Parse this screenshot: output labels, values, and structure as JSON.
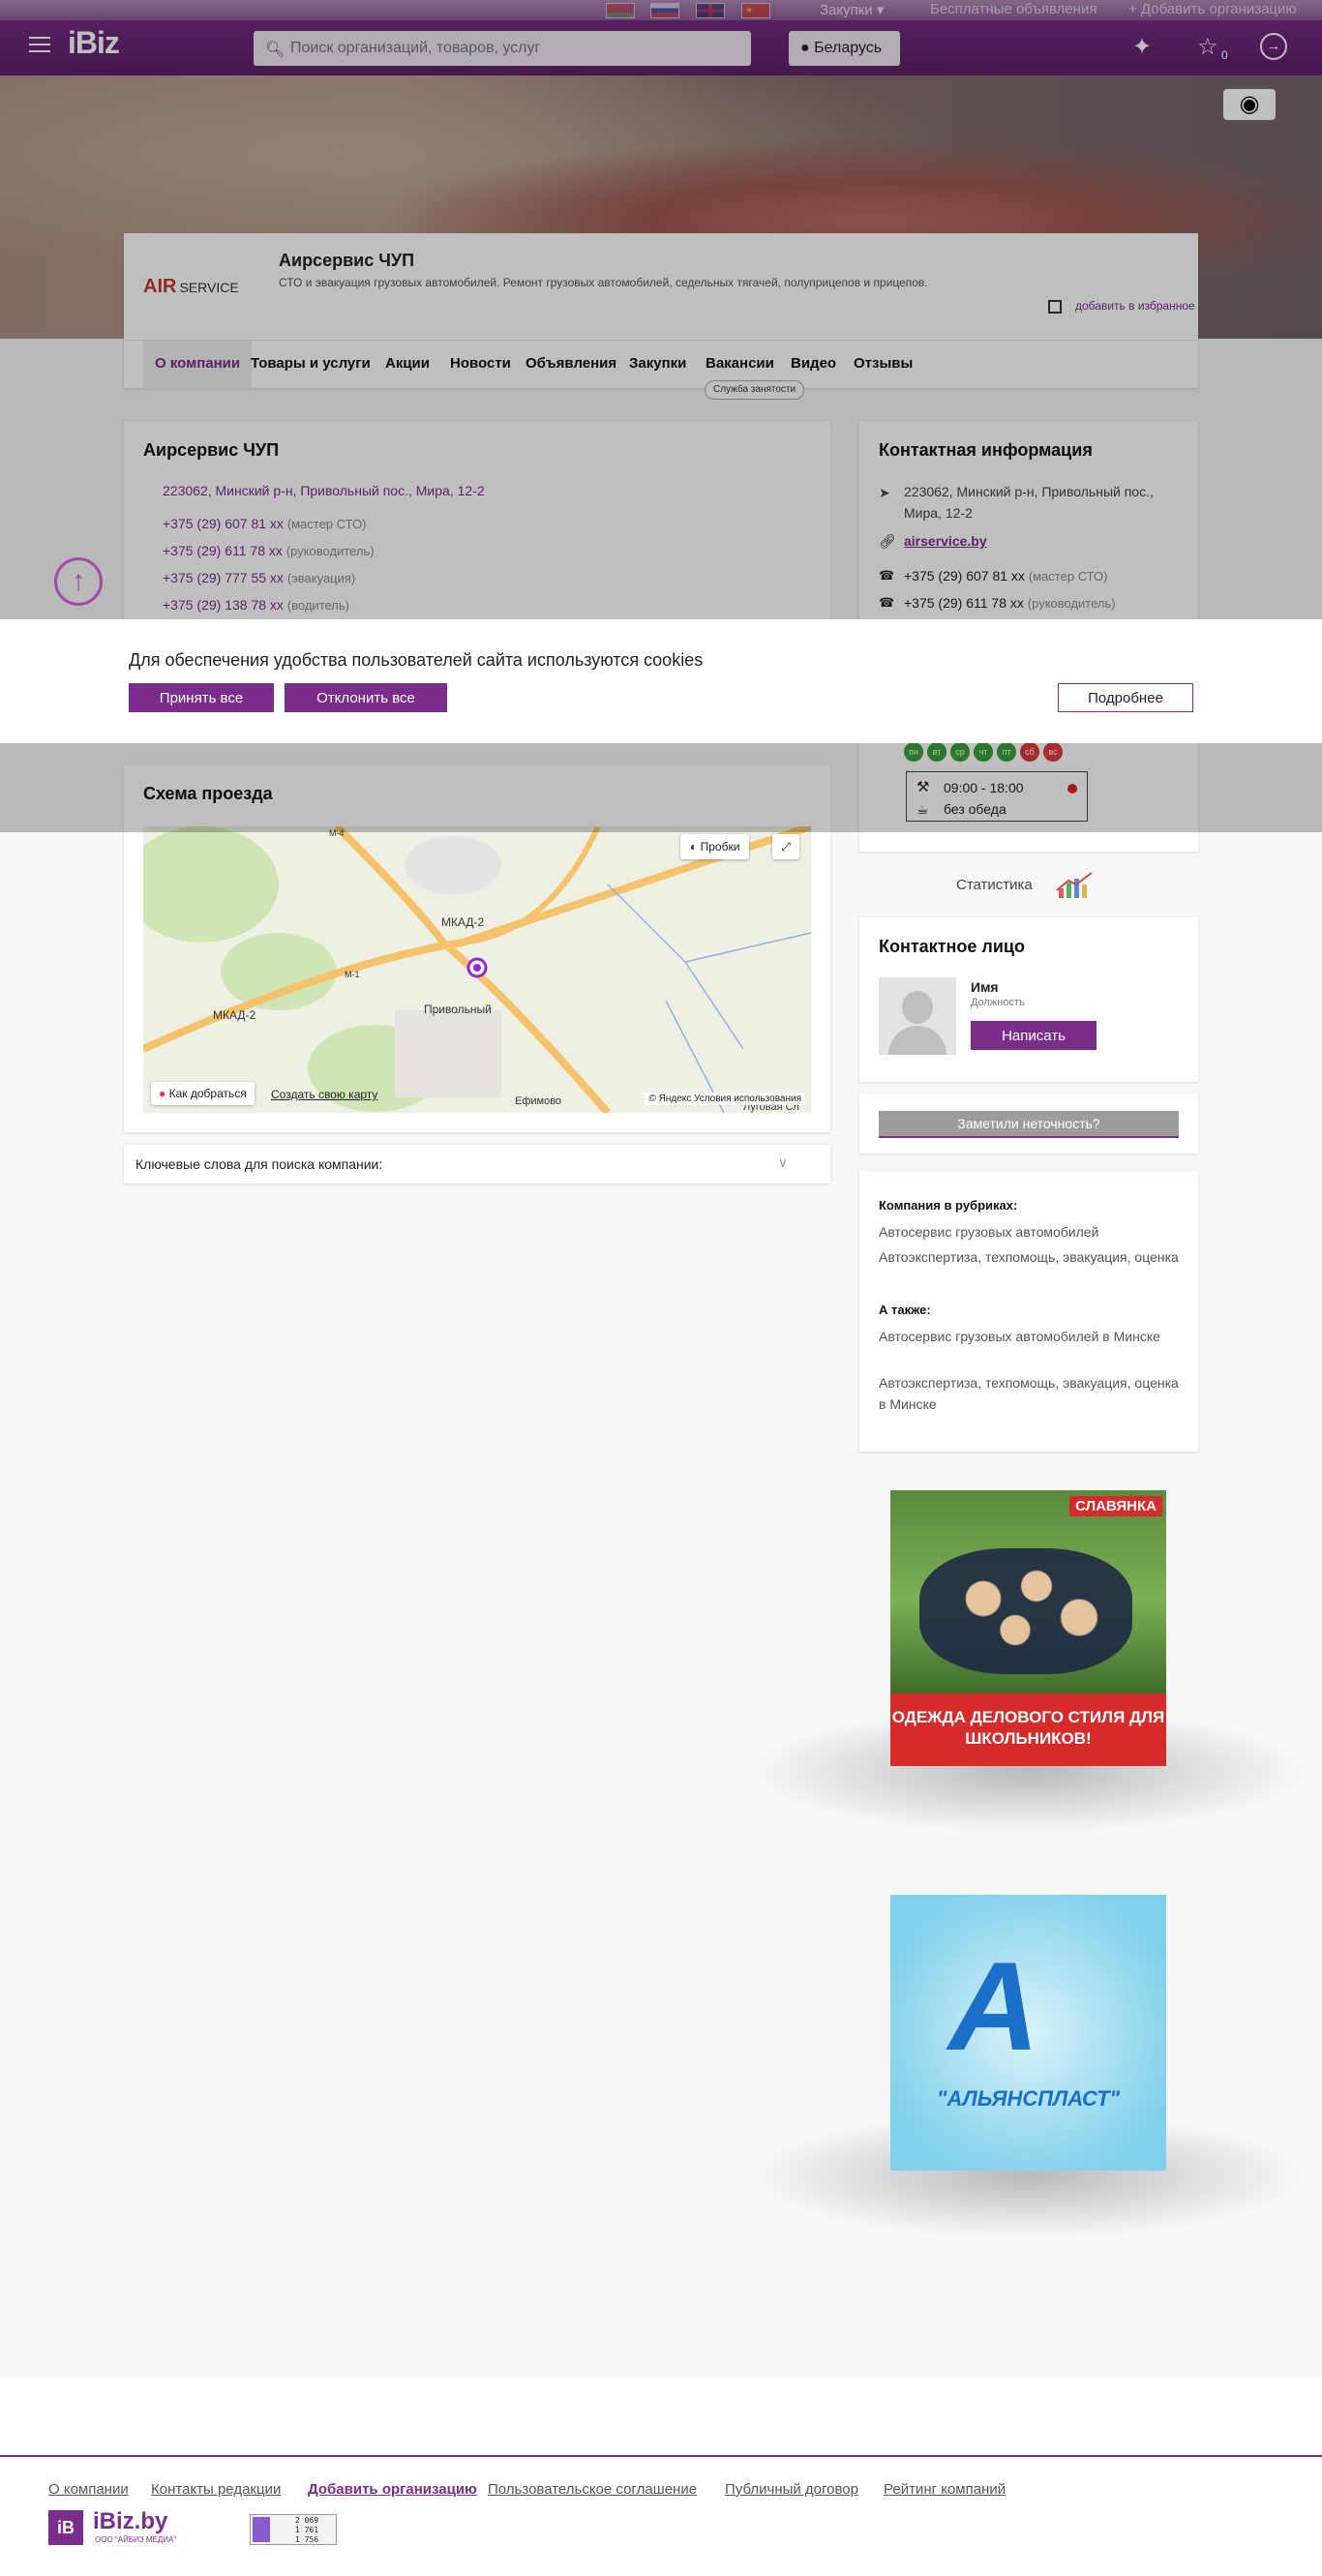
{
  "header": {
    "logo": "iBiz",
    "purchases": "Закупки ▾",
    "free_ads": "Бесплатные объявления",
    "add_org": "+ Добавить организацию",
    "search_placeholder": "Поиск организаций, товаров, услуг",
    "region": "Беларусь",
    "favorites_count": "0",
    "icons": {
      "search": "search-icon",
      "region": "map-pin-icon",
      "deals": "handshake-icon",
      "favorites": "star-icon",
      "login": "login-icon"
    }
  },
  "company": {
    "logo_text": "AIR",
    "logo_sub": "SERVICE",
    "name": "Аирсервис ЧУП",
    "description": "СТО и эвакуация грузовых автомобилей. Ремонт грузовых автомобилей, седельных тягачей, полуприцепов и прицепов.",
    "add_favorites": "добавить в избранное"
  },
  "tabs": [
    "О компании",
    "Товары и услуги",
    "Акции",
    "Новости",
    "Объявления",
    "Закупки",
    "Вакансии",
    "Видео",
    "Отзывы"
  ],
  "job_service": "Служба занятости",
  "social": {
    "vk": "vk",
    "ok": "ok",
    "viber": "vb"
  },
  "about": {
    "title": "Аирсервис ЧУП",
    "address": "223062, Минский р-н, Привольный пос., Мира, 12-2",
    "phones": [
      {
        "number": "+375 (29) 607 81 xx",
        "note": "(мастер СТО)"
      },
      {
        "number": "+375 (29) 611 78 xx",
        "note": "(руководитель)"
      },
      {
        "number": "+375 (29) 777 55 xx",
        "note": "(эвакуация)"
      },
      {
        "number": "+375 (29) 138 78 xx",
        "note": "(водитель)"
      }
    ]
  },
  "contacts": {
    "title": "Контактная информация",
    "address": "223062, Минский р-н, Привольный пос., Мира, 12-2",
    "site": "airservice.by",
    "phones": [
      {
        "number": "+375 (29) 607 81 xx",
        "note": "(мастер СТО)"
      },
      {
        "number": "+375 (29) 611 78 xx",
        "note": "(руководитель)"
      }
    ],
    "days": [
      "пн",
      "вт",
      "ср",
      "чт",
      "пт",
      "сб",
      "вс"
    ],
    "hours": "09:00 - 18:00",
    "lunch": "без обеда"
  },
  "cookie": {
    "text": "Для обеспечения удобства пользователей сайта используются cookies",
    "accept": "Принять все",
    "decline": "Отклонить все",
    "more": "Подробнее"
  },
  "map": {
    "title": "Схема проезда",
    "traffic": "Пробки",
    "route": "Как добраться",
    "create": "Создать свою карту",
    "copyright": "© Яндекс Условия использования",
    "labels": {
      "mkad_1": "МКАД-2",
      "mkad_2": "МКАД-2",
      "m4": "М-4",
      "m1": "М-1",
      "village": "Привольный",
      "efimovo": "Ефимово",
      "lugovaya": "Луговая Сл"
    }
  },
  "keywords": "Ключевые слова для поиска компании:",
  "stats": "Статистика",
  "person": {
    "title": "Контактное лицо",
    "name": "Имя",
    "position": "Должность",
    "write": "Написать"
  },
  "inaccuracy": "Заметили неточность?",
  "rubrics": {
    "title": "Компания в рубриках:",
    "items": [
      "Автосервис грузовых автомобилей",
      "Автоэкспертиза, техпомощь, эвакуация, оценка"
    ],
    "also_title": "А также:",
    "also": [
      "Автосервис грузовых автомобилей в Минске",
      "Автоэкспертиза, техпомощь, эвакуация, оценка в Минске"
    ]
  },
  "banners": {
    "b1_brand": "СЛАВЯНКА",
    "b1_slogan": "ОДЕЖДА ДЕЛОВОГО СТИЛЯ ДЛЯ ШКОЛЬНИКОВ!",
    "b2_name": "\"АЛЬЯНСПЛАСТ\""
  },
  "footer": {
    "links": [
      "О компании",
      "Контакты редакции",
      "Добавить организацию",
      "Пользовательское соглашение",
      "Публичный договор",
      "Рейтинг компаний"
    ],
    "logo": "iBiz.by",
    "logo_sq": "iB",
    "sub": "ООО \"АЙБИЗ МЕДИА\"",
    "counter": [
      "2 069",
      "1 761",
      "1 756"
    ]
  }
}
